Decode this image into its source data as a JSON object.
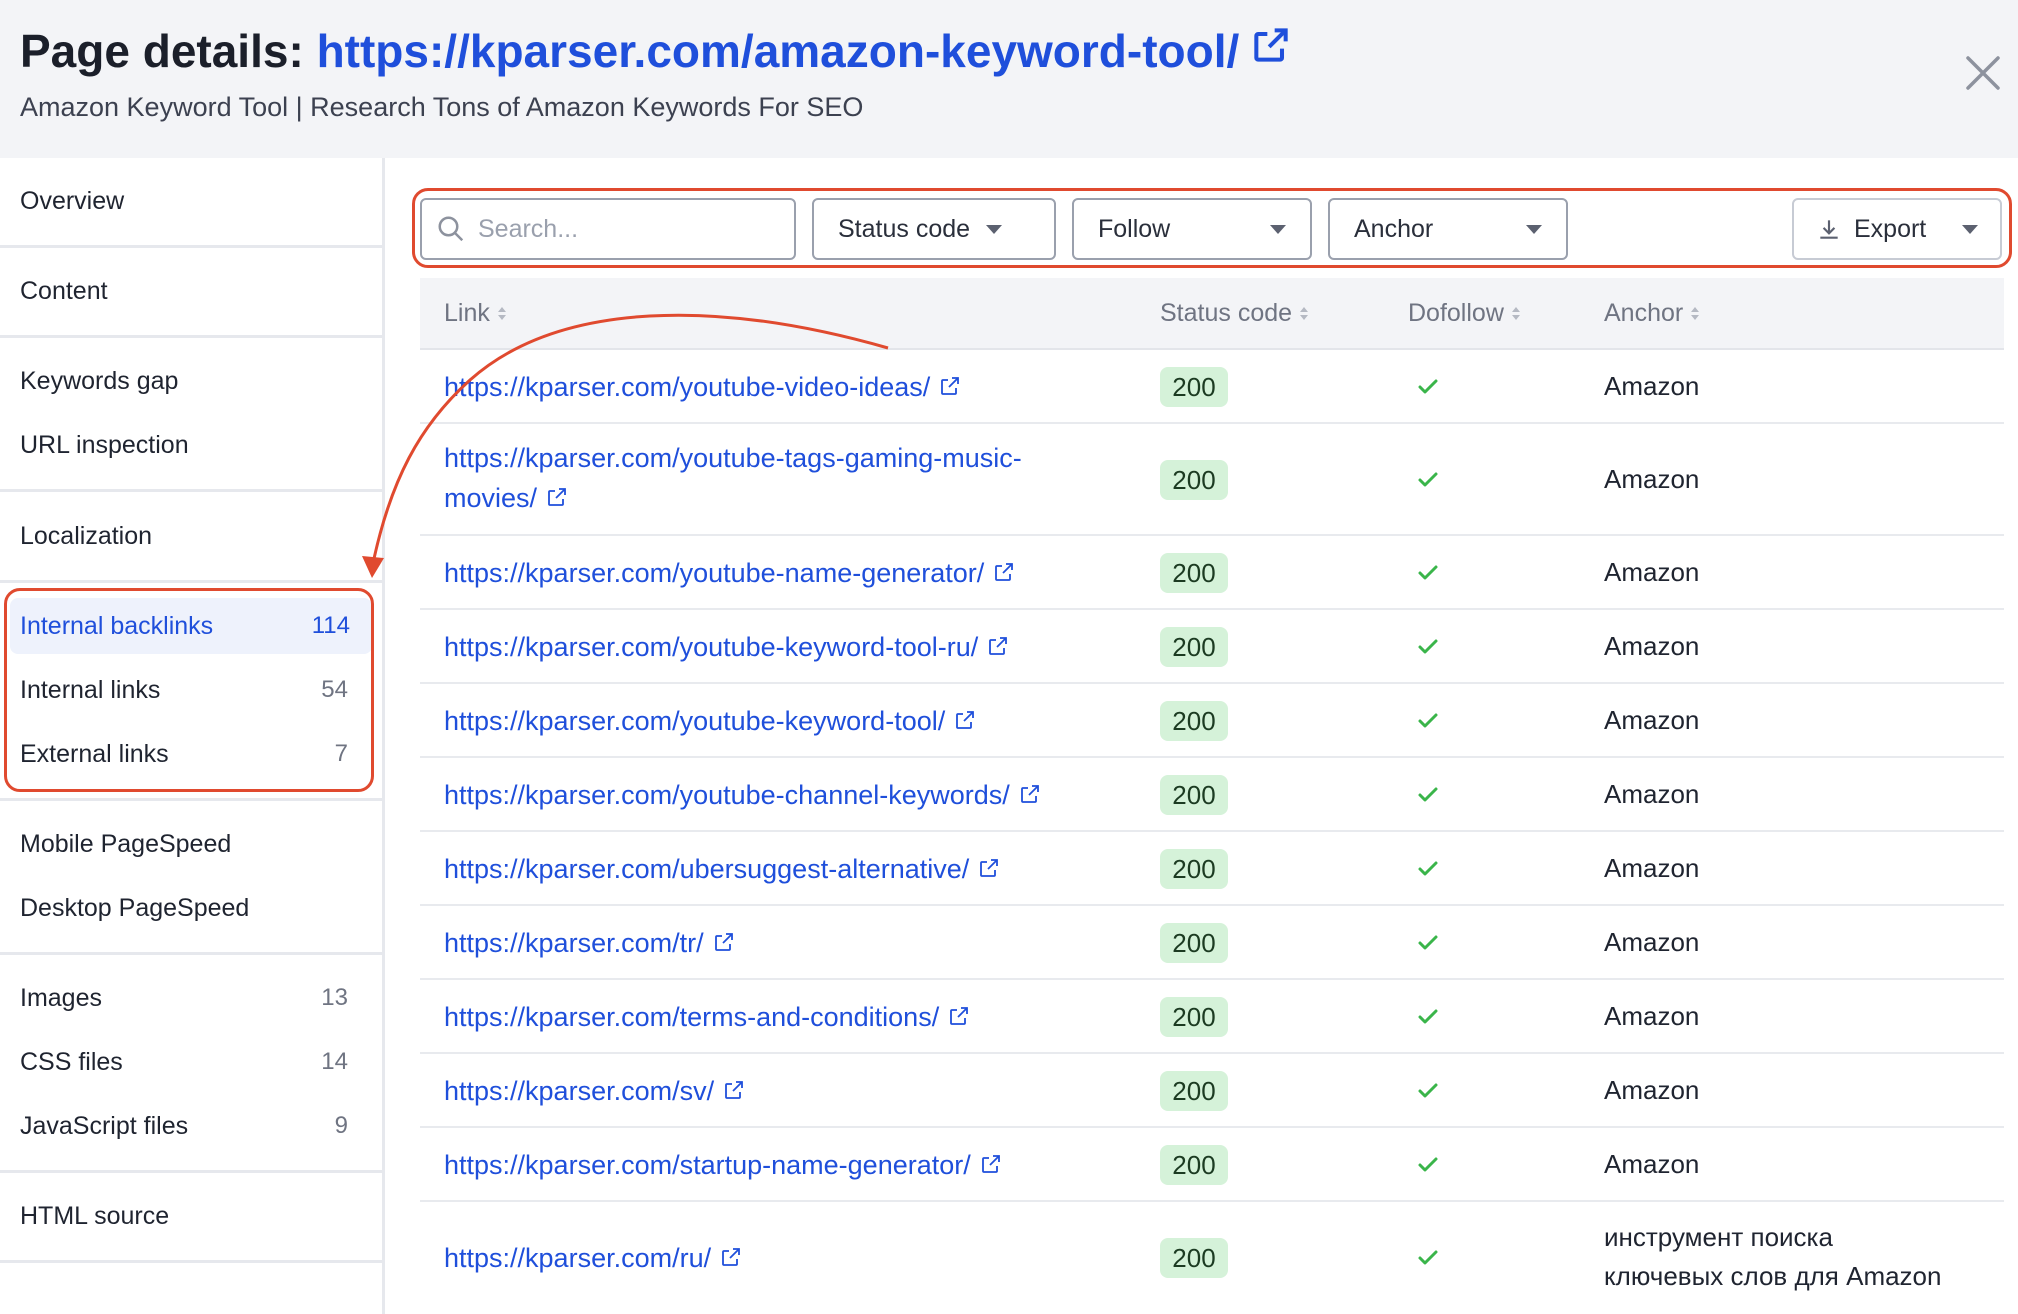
{
  "header": {
    "title_prefix": "Page details:",
    "url": "https://kparser.com/amazon-keyword-tool/",
    "subtitle": "Amazon Keyword Tool | Research Tons of Amazon Keywords For SEO"
  },
  "sidebar": {
    "items": [
      {
        "label": "Overview",
        "count": ""
      },
      {
        "label": "Content",
        "count": ""
      },
      {
        "label": "Keywords gap",
        "count": ""
      },
      {
        "label": "URL inspection",
        "count": ""
      },
      {
        "label": "Localization",
        "count": ""
      },
      {
        "label": "Internal backlinks",
        "count": "114"
      },
      {
        "label": "Internal links",
        "count": "54"
      },
      {
        "label": "External links",
        "count": "7"
      },
      {
        "label": "Mobile PageSpeed",
        "count": ""
      },
      {
        "label": "Desktop PageSpeed",
        "count": ""
      },
      {
        "label": "Images",
        "count": "13"
      },
      {
        "label": "CSS files",
        "count": "14"
      },
      {
        "label": "JavaScript files",
        "count": "9"
      },
      {
        "label": "HTML source",
        "count": ""
      }
    ],
    "active_item": "Internal backlinks"
  },
  "toolbar": {
    "search_placeholder": "Search...",
    "filters": [
      "Status code",
      "Follow",
      "Anchor"
    ],
    "export_label": "Export"
  },
  "table": {
    "columns": [
      "Link",
      "Status code",
      "Dofollow",
      "Anchor"
    ],
    "rows": [
      {
        "link": "https://kparser.com/youtube-video-ideas/",
        "status": "200",
        "dofollow": true,
        "anchor": "Amazon"
      },
      {
        "link_line1": "https://kparser.com/youtube-tags-gaming-music-",
        "link_line2": "movies/",
        "status": "200",
        "dofollow": true,
        "anchor": "Amazon"
      },
      {
        "link": "https://kparser.com/youtube-name-generator/",
        "status": "200",
        "dofollow": true,
        "anchor": "Amazon"
      },
      {
        "link": "https://kparser.com/youtube-keyword-tool-ru/",
        "status": "200",
        "dofollow": true,
        "anchor": "Amazon"
      },
      {
        "link": "https://kparser.com/youtube-keyword-tool/",
        "status": "200",
        "dofollow": true,
        "anchor": "Amazon"
      },
      {
        "link": "https://kparser.com/youtube-channel-keywords/",
        "status": "200",
        "dofollow": true,
        "anchor": "Amazon"
      },
      {
        "link": "https://kparser.com/ubersuggest-alternative/",
        "status": "200",
        "dofollow": true,
        "anchor": "Amazon"
      },
      {
        "link": "https://kparser.com/tr/",
        "status": "200",
        "dofollow": true,
        "anchor": "Amazon"
      },
      {
        "link": "https://kparser.com/terms-and-conditions/",
        "status": "200",
        "dofollow": true,
        "anchor": "Amazon"
      },
      {
        "link": "https://kparser.com/sv/",
        "status": "200",
        "dofollow": true,
        "anchor": "Amazon"
      },
      {
        "link": "https://kparser.com/startup-name-generator/",
        "status": "200",
        "dofollow": true,
        "anchor": "Amazon"
      },
      {
        "link": "https://kparser.com/ru/",
        "status": "200",
        "dofollow": true,
        "anchor_line1": "инструмент поиска",
        "anchor_line2": "ключевых слов для Amazon"
      }
    ]
  },
  "colors": {
    "link_blue": "#1f4fdb",
    "badge_green_bg": "#d5f2d9",
    "check_green": "#3ab54a",
    "annotation_red": "#e04a2f",
    "header_bg": "#f3f4f7"
  },
  "icons": {
    "external": "external-link-icon",
    "close": "close-icon",
    "search": "search-icon",
    "download": "download-icon",
    "check": "check-icon"
  }
}
